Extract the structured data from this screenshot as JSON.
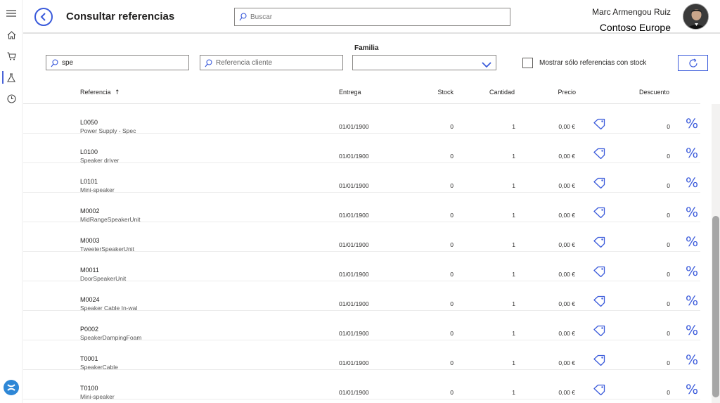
{
  "rail": {
    "items": [
      {
        "name": "menu"
      },
      {
        "name": "home"
      },
      {
        "name": "cart"
      },
      {
        "name": "references",
        "active": true
      },
      {
        "name": "history"
      }
    ]
  },
  "header": {
    "title": "Consultar referencias",
    "search_placeholder": "Buscar",
    "user_name": "Marc Armengou Ruiz",
    "company": "Contoso Europe"
  },
  "filters": {
    "reference_value": "spe",
    "client_reference_placeholder": "Referencia cliente",
    "familia_label": "Familia",
    "familia_value": "",
    "stock_only_label": "Mostrar sólo referencias con stock",
    "stock_only_checked": false
  },
  "table": {
    "columns": {
      "referencia": "Referencia",
      "sort_indicator": "↑",
      "entrega": "Entrega",
      "stock": "Stock",
      "cantidad": "Cantidad",
      "precio": "Precio",
      "descuento": "Descuento"
    },
    "partial_row_text": "...",
    "rows": [
      {
        "code": "L0050",
        "desc": "Power Supply - Spec",
        "entrega": "01/01/1900",
        "stock": "0",
        "cantidad": "1",
        "precio": "0,00 €",
        "descuento": "0"
      },
      {
        "code": "L0100",
        "desc": "Speaker driver",
        "entrega": "01/01/1900",
        "stock": "0",
        "cantidad": "1",
        "precio": "0,00 €",
        "descuento": "0"
      },
      {
        "code": "L0101",
        "desc": "Mini-speaker",
        "entrega": "01/01/1900",
        "stock": "0",
        "cantidad": "1",
        "precio": "0,00 €",
        "descuento": "0"
      },
      {
        "code": "M0002",
        "desc": "MidRangeSpeakerUnit",
        "entrega": "01/01/1900",
        "stock": "0",
        "cantidad": "1",
        "precio": "0,00 €",
        "descuento": "0"
      },
      {
        "code": "M0003",
        "desc": "TweeterSpeakerUnit",
        "entrega": "01/01/1900",
        "stock": "0",
        "cantidad": "1",
        "precio": "0,00 €",
        "descuento": "0"
      },
      {
        "code": "M0011",
        "desc": "DoorSpeakerUnit",
        "entrega": "01/01/1900",
        "stock": "0",
        "cantidad": "1",
        "precio": "0,00 €",
        "descuento": "0"
      },
      {
        "code": "M0024",
        "desc": "Speaker Cable In-wal",
        "entrega": "01/01/1900",
        "stock": "0",
        "cantidad": "1",
        "precio": "0,00 €",
        "descuento": "0"
      },
      {
        "code": "P0002",
        "desc": "SpeakerDampingFoam",
        "entrega": "01/01/1900",
        "stock": "0",
        "cantidad": "1",
        "precio": "0,00 €",
        "descuento": "0"
      },
      {
        "code": "T0001",
        "desc": "SpeakerCable",
        "entrega": "01/01/1900",
        "stock": "0",
        "cantidad": "1",
        "precio": "0,00 €",
        "descuento": "0"
      },
      {
        "code": "T0100",
        "desc": "Mini-speaker",
        "entrega": "01/01/1900",
        "stock": "0",
        "cantidad": "1",
        "precio": "0,00 €",
        "descuento": "0"
      }
    ],
    "discount_symbol": "%"
  },
  "colors": {
    "accent": "#3b5bdb",
    "text": "#201f1e",
    "border": "#8a8886"
  }
}
